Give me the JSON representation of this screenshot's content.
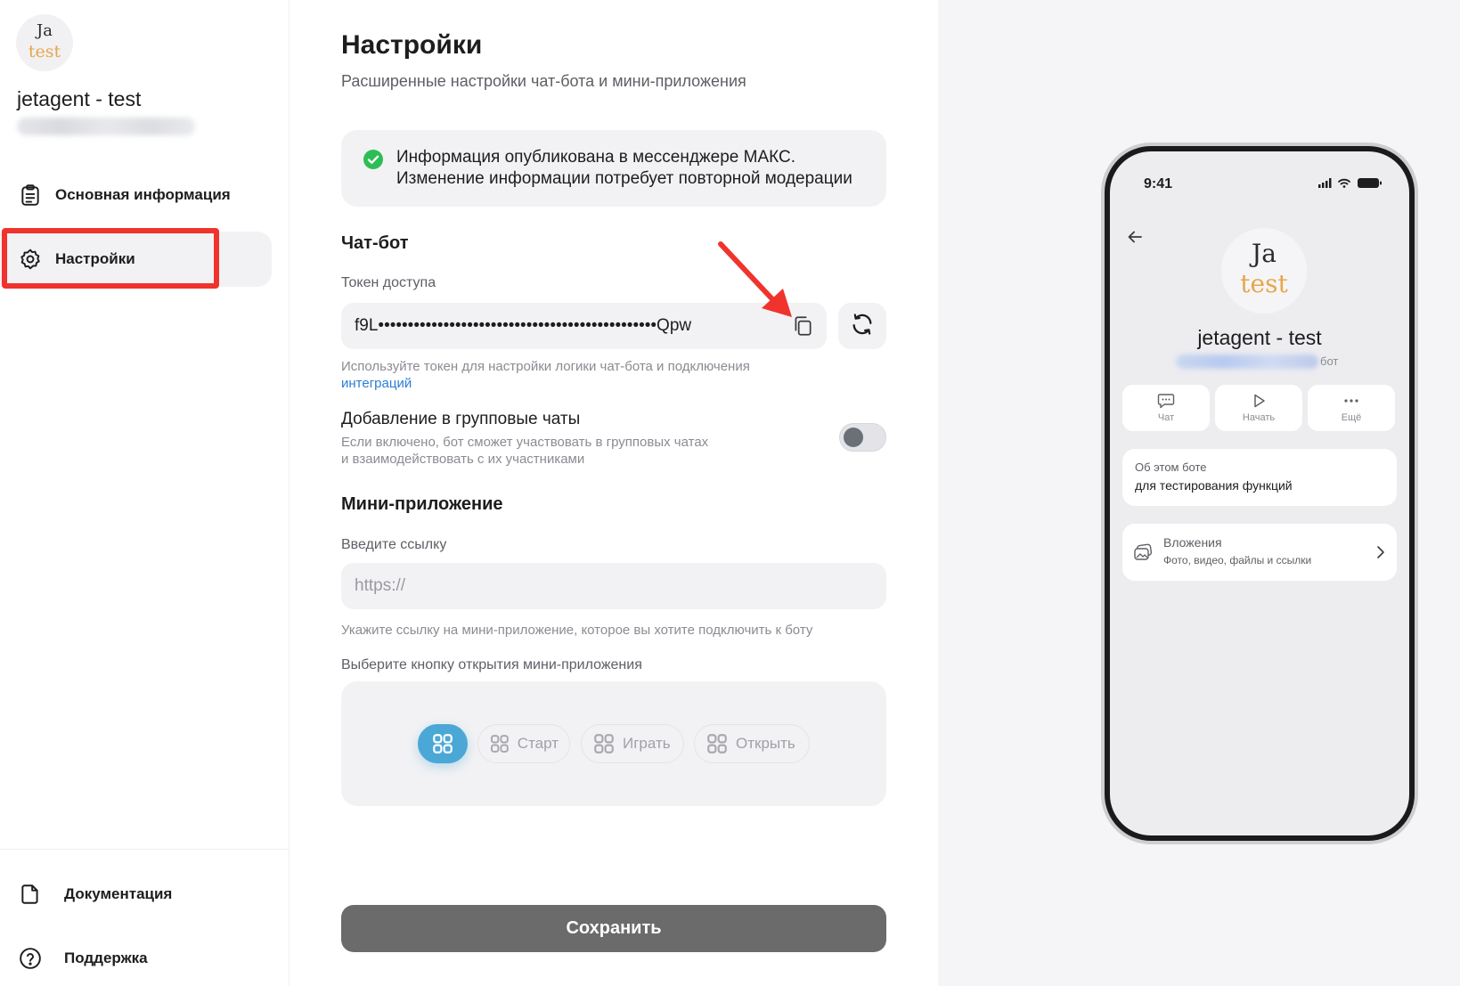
{
  "bot": {
    "name": "jetagent - test",
    "avatar_text_top": "Ja",
    "avatar_text_bottom": "test"
  },
  "sidebar": {
    "items": [
      {
        "label": "Основная информация",
        "icon": "clipboard-icon"
      },
      {
        "label": "Настройки",
        "icon": "gear-icon",
        "active": true
      }
    ],
    "bottom_items": [
      {
        "label": "Документация",
        "icon": "document-icon"
      },
      {
        "label": "Поддержка",
        "icon": "help-circle-icon"
      }
    ]
  },
  "page": {
    "title": "Настройки",
    "subtitle": "Расширенные настройки чат-бота и мини-приложения"
  },
  "notice": {
    "line1": "Информация опубликована в мессенджере МАКС.",
    "line2": "Изменение информации потребует повторной модерации"
  },
  "chatbot": {
    "heading": "Чат-бот",
    "token_label": "Токен доступа",
    "token_value": "f9L•••••••••••••••••••••••••••••••••••••••••••••••Qpw",
    "token_hint": "Используйте токен для настройки логики чат-бота и подключения",
    "token_hint_link": "интеграций",
    "group_title": "Добавление в групповые чаты",
    "group_hint_1": "Если включено, бот сможет участвовать в групповых чатах",
    "group_hint_2": "и взаимодействовать с их участниками",
    "group_enabled": false
  },
  "mini_app": {
    "heading": "Мини-приложение",
    "url_label": "Введите ссылку",
    "url_placeholder": "https://",
    "url_value": "",
    "url_hint": "Укажите ссылку на мини-приложение, которое вы хотите подключить к боту",
    "button_label": "Выберите кнопку открытия мини-приложения",
    "button_options": [
      "Старт",
      "Играть",
      "Открыть"
    ],
    "selected_option": "icon-only"
  },
  "save_label": "Сохранить",
  "preview": {
    "time": "9:41",
    "bot_suffix": "бот",
    "actions": [
      "Чат",
      "Начать",
      "Ещё"
    ],
    "about_heading": "Об этом боте",
    "about_text": "для тестирования функций",
    "attachments_title": "Вложения",
    "attachments_sub": "Фото, видео, файлы и ссылки"
  },
  "colors": {
    "accent": "#4ba8d6",
    "highlight": "#f0332d",
    "success": "#2dbd55",
    "link": "#2b7fd4",
    "save_button": "#6b6b6b"
  }
}
